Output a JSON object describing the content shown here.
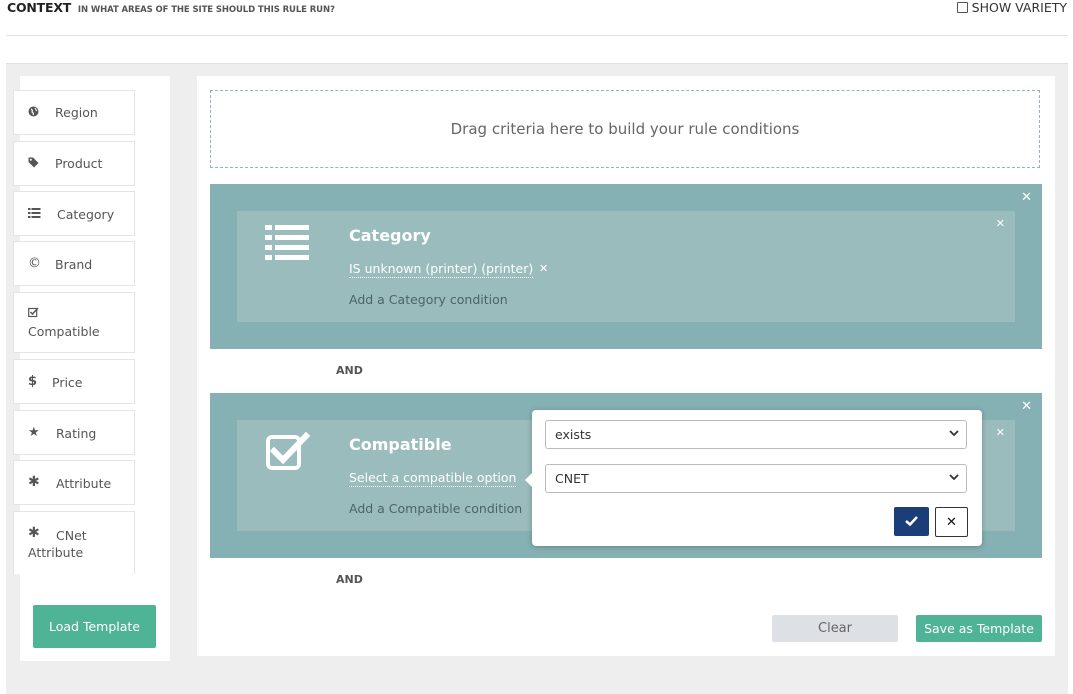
{
  "header": {
    "title": "CONTEXT",
    "subtitle": "IN WHAT AREAS OF THE SITE SHOULD THIS RULE RUN?",
    "show_variety_label": "SHOW VARIETY"
  },
  "sidebar": {
    "items": [
      {
        "label": "Region",
        "icon": "globe-icon"
      },
      {
        "label": "Product",
        "icon": "tag-icon"
      },
      {
        "label": "Category",
        "icon": "list-icon"
      },
      {
        "label": "Brand",
        "icon": "copyright-icon"
      },
      {
        "label": "Compatible",
        "icon": "checkbox-icon"
      },
      {
        "label": "Price",
        "icon": "dollar-icon"
      },
      {
        "label": "Rating",
        "icon": "star-icon"
      },
      {
        "label": "Attribute",
        "icon": "asterisk-icon"
      },
      {
        "label": "CNet Attribute",
        "icon": "asterisk-icon"
      }
    ],
    "load_template_label": "Load Template"
  },
  "main": {
    "drop_zone_text": "Drag criteria here to build your rule conditions",
    "criteria": [
      {
        "title": "Category",
        "condition": "IS unknown (printer) (printer)",
        "add_label": "Add a Category condition",
        "icon": "list-icon"
      },
      {
        "title": "Compatible",
        "condition": "Select a compatible option",
        "add_label": "Add a Compatible condition",
        "icon": "checkbox-icon"
      }
    ],
    "and_labels": [
      "AND",
      "AND"
    ],
    "clear_label": "Clear",
    "save_template_label": "Save as Template"
  },
  "popover": {
    "operator_value": "exists",
    "source_value": "CNET"
  },
  "colors": {
    "accent_green": "#4fb495",
    "criteria_bg": "#86b1b4",
    "criteria_inner_bg": "#9bbcbd",
    "confirm_blue": "#1c3e78"
  }
}
